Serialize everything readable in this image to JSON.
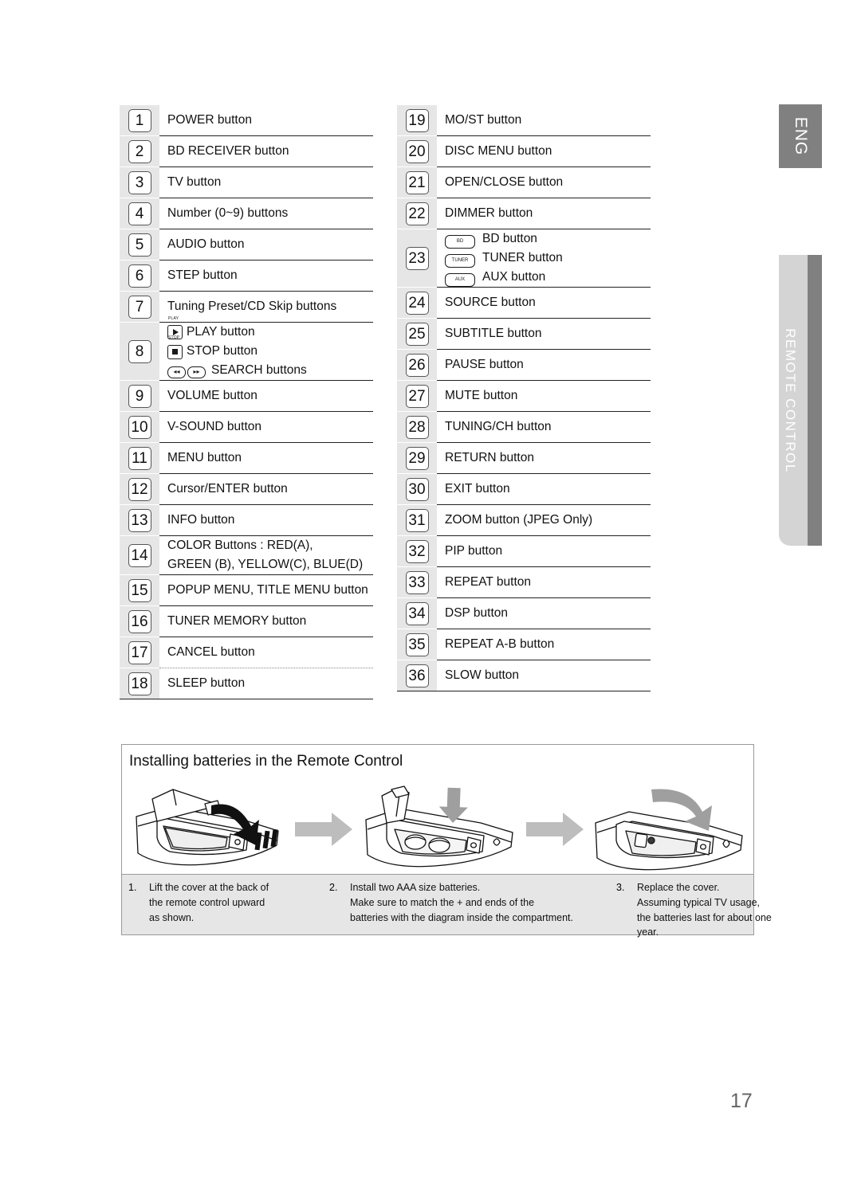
{
  "side_tabs": {
    "language": "ENG",
    "section": "REMOTE CONTROL"
  },
  "page_number": "17",
  "button_list": {
    "left_column": [
      {
        "num": "1",
        "label": "POWER button"
      },
      {
        "num": "2",
        "label": "BD RECEIVER button"
      },
      {
        "num": "3",
        "label": "TV button"
      },
      {
        "num": "4",
        "label": "Number (0~9) buttons"
      },
      {
        "num": "5",
        "label": "AUDIO button"
      },
      {
        "num": "6",
        "label": "STEP button"
      },
      {
        "num": "7",
        "label": "Tuning Preset/CD Skip buttons"
      },
      {
        "num": "8",
        "label": "",
        "subitems": [
          {
            "icon": "play-button-icon",
            "icon_caption": "PLAY",
            "label": "PLAY button"
          },
          {
            "icon": "stop-button-icon",
            "icon_caption": "STOP",
            "label": "STOP button"
          },
          {
            "icon": "search-buttons-icon",
            "icon_caption": "",
            "label": "SEARCH buttons"
          }
        ]
      },
      {
        "num": "9",
        "label": "VOLUME button"
      },
      {
        "num": "10",
        "label": "V-SOUND button"
      },
      {
        "num": "11",
        "label": "MENU button"
      },
      {
        "num": "12",
        "label": "Cursor/ENTER button"
      },
      {
        "num": "13",
        "label": "INFO button"
      },
      {
        "num": "14",
        "label": "COLOR Buttons : RED(A),\nGREEN (B), YELLOW(C), BLUE(D)"
      },
      {
        "num": "15",
        "label": "POPUP MENU, TITLE MENU button"
      },
      {
        "num": "16",
        "label": "TUNER MEMORY button"
      },
      {
        "num": "17",
        "label": "CANCEL button"
      },
      {
        "num": "18",
        "label": "SLEEP button"
      }
    ],
    "right_column": [
      {
        "num": "19",
        "label": "MO/ST button"
      },
      {
        "num": "20",
        "label": "DISC MENU button"
      },
      {
        "num": "21",
        "label": "OPEN/CLOSE button"
      },
      {
        "num": "22",
        "label": "DIMMER button"
      },
      {
        "num": "23",
        "label": "",
        "subitems": [
          {
            "icon": "bd-button-icon",
            "icon_caption": "BD",
            "label": "BD button"
          },
          {
            "icon": "tuner-button-icon",
            "icon_caption": "TUNER",
            "label": "TUNER button"
          },
          {
            "icon": "aux-button-icon",
            "icon_caption": "AUX",
            "label": "AUX button"
          }
        ]
      },
      {
        "num": "24",
        "label": "SOURCE button"
      },
      {
        "num": "25",
        "label": "SUBTITLE button"
      },
      {
        "num": "26",
        "label": "PAUSE button"
      },
      {
        "num": "27",
        "label": "MUTE button"
      },
      {
        "num": "28",
        "label": "TUNING/CH button"
      },
      {
        "num": "29",
        "label": "RETURN button"
      },
      {
        "num": "30",
        "label": "EXIT button"
      },
      {
        "num": "31",
        "label": "ZOOM button (JPEG Only)"
      },
      {
        "num": "32",
        "label": "PIP button"
      },
      {
        "num": "33",
        "label": "REPEAT button"
      },
      {
        "num": "34",
        "label": "DSP button"
      },
      {
        "num": "35",
        "label": "REPEAT A-B button"
      },
      {
        "num": "36",
        "label": "SLOW button"
      }
    ]
  },
  "battery_section": {
    "title": "Installing batteries in the Remote Control",
    "steps": [
      {
        "num": "1.",
        "text": "Lift the cover at the back of\nthe remote control upward\nas shown."
      },
      {
        "num": "2.",
        "text": "Install two AAA size batteries.\nMake sure to match the  +  and     ends of the\nbatteries with the diagram inside the compartment."
      },
      {
        "num": "3.",
        "text": "Replace the cover.\nAssuming typical TV usage,\nthe batteries last for about one\nyear."
      }
    ]
  },
  "colors": {
    "tab_dark": "#808080",
    "tab_light": "#d4d4d4",
    "number_band": "#e6e6e6",
    "arrow_gray": "#bdbdbd",
    "page_number": "#636363"
  }
}
